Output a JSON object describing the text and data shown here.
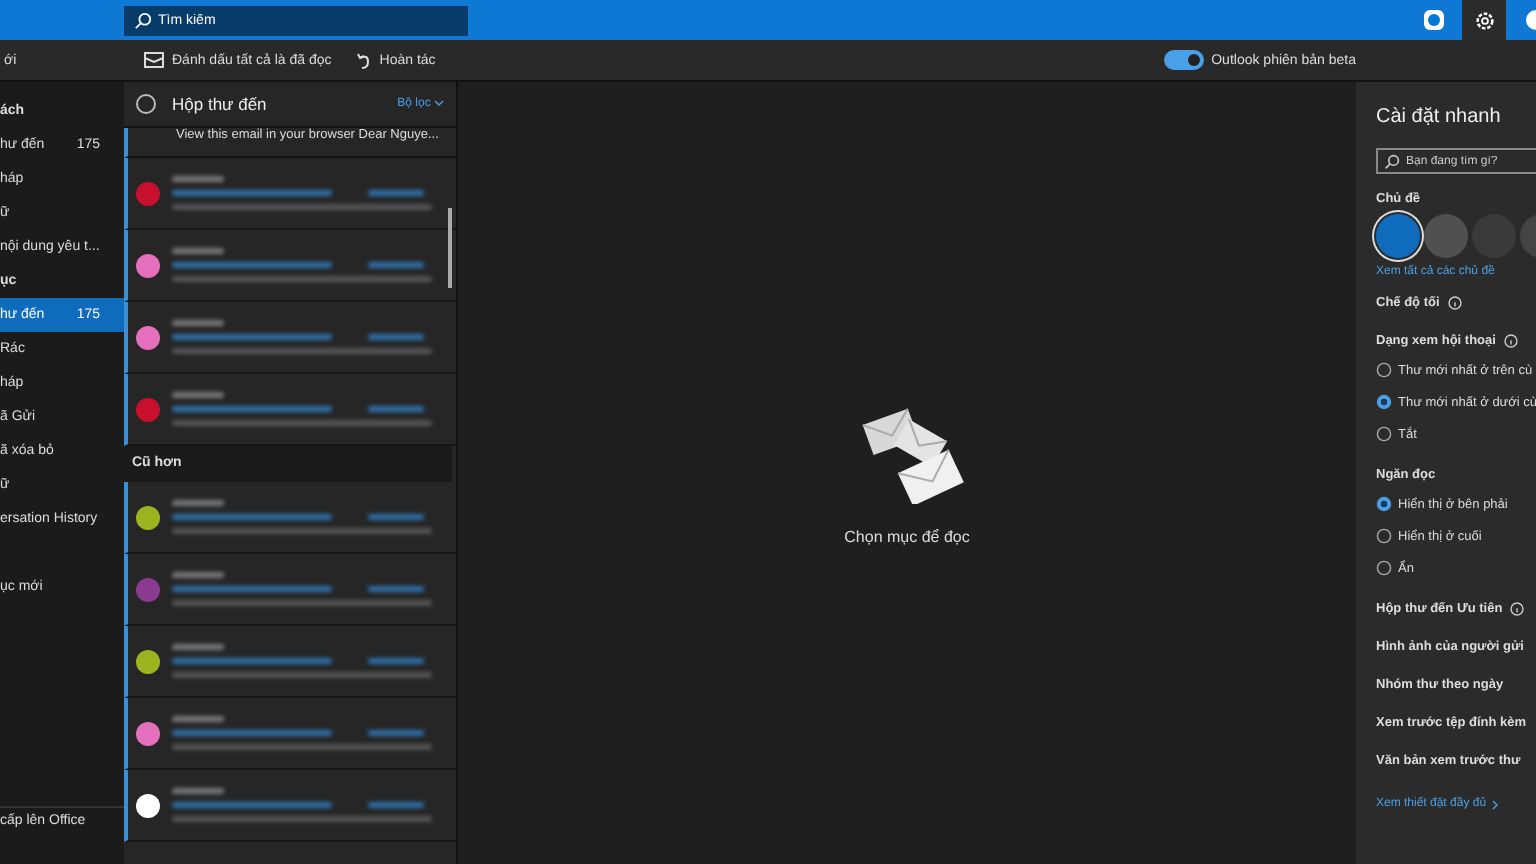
{
  "top_bar": {
    "search": {
      "placeholder": "Tìm kiếm"
    }
  },
  "command_bar": {
    "left_text": "ới",
    "actions": [
      {
        "kind": "mark-read",
        "label": "Đánh dấu tất cả là đã đọc"
      },
      {
        "kind": "undo",
        "label": "Hoàn tác"
      }
    ],
    "beta_toggle": {
      "label": "Outlook phiên bản beta",
      "on": true
    }
  },
  "sidebar": {
    "items": [
      {
        "kind": "header",
        "label": "ách"
      },
      {
        "kind": "item",
        "label": "hư đến",
        "count": "175",
        "selected": false
      },
      {
        "kind": "item",
        "label": "háp",
        "selected": false
      },
      {
        "kind": "item",
        "label": "ữ",
        "selected": false
      },
      {
        "kind": "item",
        "label": "nội dung yêu t...",
        "selected": false
      },
      {
        "kind": "header",
        "label": "ục"
      },
      {
        "kind": "item",
        "label": "hư đến",
        "count": "175",
        "selected": true
      },
      {
        "kind": "item",
        "label": "Rác",
        "selected": false
      },
      {
        "kind": "item",
        "label": "háp",
        "selected": false
      },
      {
        "kind": "item",
        "label": "ã Gửi",
        "selected": false
      },
      {
        "kind": "item",
        "label": "ã xóa bỏ",
        "selected": false
      },
      {
        "kind": "item",
        "label": "ữ",
        "selected": false
      },
      {
        "kind": "item",
        "label": "ersation History",
        "selected": false
      },
      {
        "kind": "spacer"
      },
      {
        "kind": "item",
        "label": "ục mới",
        "selected": false
      }
    ],
    "footer": "cấp lên Office"
  },
  "message_list": {
    "select_all": {
      "checked": false
    },
    "title": "Hộp thư đến",
    "filter": "Bộ lọc",
    "partial_preview": "View this email in your browser Dear Nguye...",
    "groups": [
      {
        "messages": [
          {
            "color": "#c8102e",
            "unread": true
          },
          {
            "color": "#e36fbd",
            "unread": true
          },
          {
            "color": "#e36fbd",
            "unread": true
          },
          {
            "color": "#c8102e",
            "unread": true
          }
        ]
      },
      {
        "label": "Cũ hơn",
        "messages": [
          {
            "color": "#9bb520",
            "unread": true
          },
          {
            "color": "#8a3b8f",
            "unread": true
          },
          {
            "color": "#9bb520",
            "unread": true
          },
          {
            "color": "#e36fbd",
            "unread": true
          },
          {
            "color": "#ffffff",
            "unread": true
          }
        ]
      }
    ]
  },
  "reading_pane": {
    "empty_text": "Chọn mục để đọc"
  },
  "quick_settings": {
    "title": "Cài đặt nhanh",
    "search": {
      "placeholder": "Bạn đang tìm gì?"
    },
    "sections": [
      {
        "kind": "themes",
        "title": "Chủ đề",
        "themes": [
          {
            "color": "#0f6cbd",
            "selected": true
          },
          {
            "color": "#505050",
            "selected": false
          },
          {
            "color": "#3a3a3a",
            "selected": false
          },
          {
            "color": "#444444",
            "selected": false
          }
        ],
        "link": "Xem tất cả các chủ đề"
      },
      {
        "kind": "heading",
        "title": "Chế độ tối",
        "info": true
      },
      {
        "kind": "radios",
        "title": "Dạng xem hội thoại",
        "info": true,
        "options": [
          {
            "label": "Thư mới nhất ở trên cù",
            "selected": false
          },
          {
            "label": "Thư mới nhất ở dưới cù",
            "selected": true
          },
          {
            "label": "Tắt",
            "selected": false
          }
        ]
      },
      {
        "kind": "radios",
        "title": "Ngăn đọc",
        "info": false,
        "options": [
          {
            "label": "Hiển thị ở bên phải",
            "selected": true
          },
          {
            "label": "Hiển thị ở cuối",
            "selected": false
          },
          {
            "label": "Ẩn",
            "selected": false
          }
        ]
      },
      {
        "kind": "heading",
        "title": "Hộp thư đến Ưu tiên",
        "info": true
      },
      {
        "kind": "heading",
        "title": "Hình ảnh của người gửi",
        "info": false
      },
      {
        "kind": "heading",
        "title": "Nhóm thư theo ngày",
        "info": false
      },
      {
        "kind": "heading",
        "title": "Xem trước tệp đính kèm",
        "info": false
      },
      {
        "kind": "heading",
        "title": "Văn bản xem trước thư",
        "info": false
      }
    ],
    "footer_link": "Xem thiết đặt đầy đủ"
  }
}
